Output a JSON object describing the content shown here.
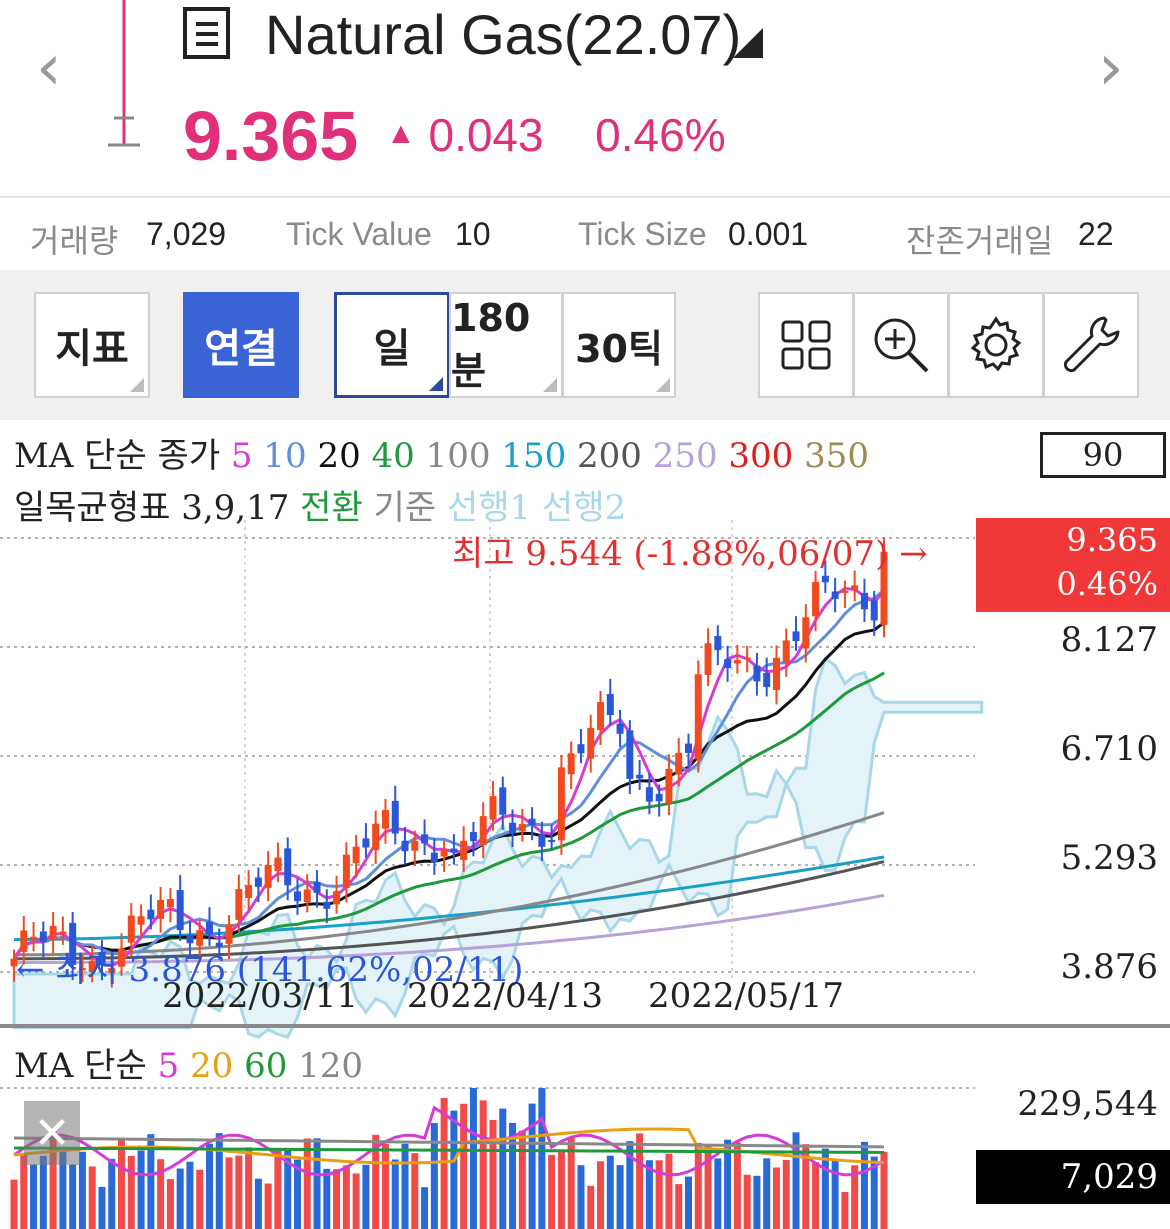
{
  "header": {
    "title": "Natural Gas(22.07)",
    "price": "9.365",
    "change": "0.043",
    "change_pct": "0.46%",
    "up_color": "#e0307a"
  },
  "info": {
    "volume_label": "거래량",
    "volume": "7,029",
    "tick_value_label": "Tick Value",
    "tick_value": "10",
    "tick_size_label": "Tick Size",
    "tick_size": "0.001",
    "days_left_label": "잔존거래일",
    "days_left": "22"
  },
  "toolbar": {
    "indicator": "지표",
    "link": "연결",
    "day": "일",
    "min180": "180분",
    "tick30": "30틱",
    "icons": [
      "grid-layout-icon",
      "zoom-in-icon",
      "settings-gear-icon",
      "wrench-icon"
    ]
  },
  "legend": {
    "ma_title": "MA 단순 종가",
    "ma_periods": [
      {
        "label": "5",
        "color": "#d63bd6"
      },
      {
        "label": "10",
        "color": "#5f8fd8"
      },
      {
        "label": "20",
        "color": "#111111"
      },
      {
        "label": "40",
        "color": "#1f9a3a"
      },
      {
        "label": "100",
        "color": "#888888"
      },
      {
        "label": "150",
        "color": "#1aa0c8"
      },
      {
        "label": "200",
        "color": "#555555"
      },
      {
        "label": "250",
        "color": "#b7a3d8"
      },
      {
        "label": "300",
        "color": "#e02020"
      },
      {
        "label": "350",
        "color": "#a08a50"
      }
    ],
    "ichimoku_title": "일목균형표 3,9,17",
    "ichimoku_items": [
      {
        "label": "전환",
        "color": "#1f9a3a"
      },
      {
        "label": "기준",
        "color": "#888888"
      },
      {
        "label": "선행1",
        "color": "#a8d8e8"
      },
      {
        "label": "선행2",
        "color": "#a8d8e8"
      }
    ],
    "period_box": "90"
  },
  "price_axis": [
    "8.127",
    "6.710",
    "5.293",
    "3.876"
  ],
  "price_tag": {
    "price": "9.365",
    "pct": "0.46%",
    "color": "#f03838"
  },
  "annotations": {
    "high": "최고 9.544 (-1.88%,06/07) →",
    "low": "← 최저 3.876 (141.62%,02/11)"
  },
  "x_axis": [
    "2022/03/11",
    "2022/04/13",
    "2022/05/17"
  ],
  "volume_panel": {
    "title": "MA 단순",
    "periods": [
      {
        "label": "5",
        "color": "#d63bd6"
      },
      {
        "label": "20",
        "color": "#e8a010"
      },
      {
        "label": "60",
        "color": "#1f9a3a"
      },
      {
        "label": "120",
        "color": "#888888"
      }
    ],
    "axis_top": "229,544",
    "current": "7,029"
  },
  "chart_data": {
    "type": "candlestick",
    "y_range": [
      3.876,
      9.544
    ],
    "high": 9.544,
    "low": 3.876,
    "last": 9.365
  }
}
